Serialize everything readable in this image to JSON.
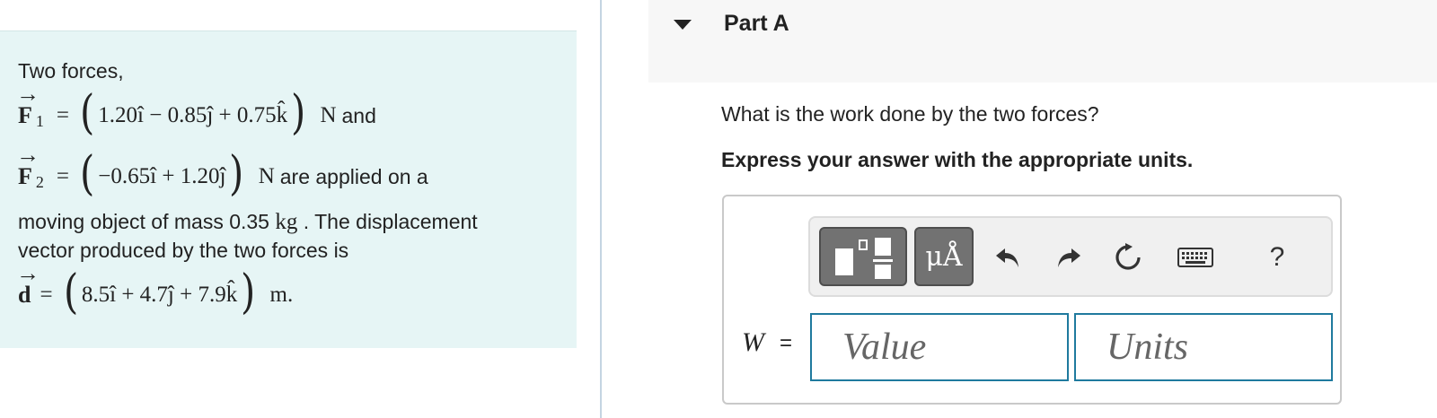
{
  "problem": {
    "intro": "Two forces,",
    "f1": {
      "sym": "F",
      "sub": "1",
      "eq": "=",
      "open": "(",
      "close": ")",
      "expr": "1.20î − 0.85ĵ + 0.75k̂",
      "unit": "N",
      "after": "and"
    },
    "f2": {
      "sym": "F",
      "sub": "2",
      "eq": "=",
      "open": "(",
      "close": ")",
      "expr": "−0.65î + 1.20ĵ",
      "unit": "N",
      "after": "are applied on a"
    },
    "mass_line": {
      "before": "moving object of mass 0.35",
      "unit": "kg",
      "after": ". The displacement"
    },
    "vector_line": "vector produced by the two forces is",
    "d": {
      "sym": "d",
      "eq": "=",
      "open": "(",
      "close": ")",
      "expr": "8.5î + 4.7ĵ + 7.9k̂",
      "unit": "m."
    },
    "arrow": "→"
  },
  "part": {
    "title": "Part A"
  },
  "question": "What is the work done by the two forces?",
  "instruction": "Express your answer with the appropriate units.",
  "toolbar": {
    "units_label": "μÅ",
    "help_label": "?"
  },
  "answer": {
    "variable": "W",
    "equals": "=",
    "value_placeholder": "Value",
    "units_placeholder": "Units"
  }
}
